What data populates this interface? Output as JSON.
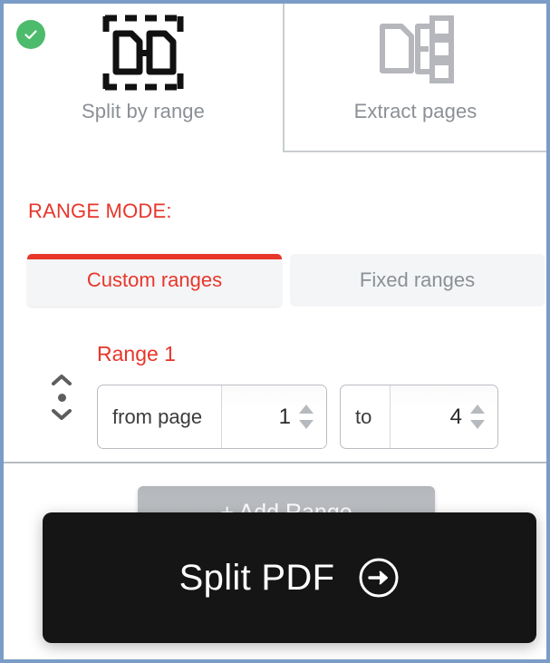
{
  "tabs": [
    {
      "id": "split-by-range",
      "label": "Split by range",
      "icon": "split-document-icon",
      "selected": true,
      "badge": "check-badge"
    },
    {
      "id": "extract-pages",
      "label": "Extract pages",
      "icon": "extract-pages-icon",
      "selected": false
    }
  ],
  "range_mode": {
    "heading": "RANGE MODE:",
    "options": [
      {
        "id": "custom-ranges",
        "label": "Custom ranges",
        "selected": true
      },
      {
        "id": "fixed-ranges",
        "label": "Fixed ranges",
        "selected": false
      }
    ]
  },
  "ranges": [
    {
      "title": "Range 1",
      "from": {
        "label": "from page",
        "value": "1"
      },
      "to": {
        "label": "to",
        "value": "4"
      }
    }
  ],
  "footer": {
    "add_range_label": "+ Add Range",
    "submit_label": "Split PDF",
    "submit_icon": "arrow-right-circle-icon"
  },
  "colors": {
    "accent_red": "#e8362b",
    "badge_green": "#4cbb6c",
    "submit_bg": "#151515",
    "muted_text": "#8b9096",
    "frame_border": "#7a9cc6"
  }
}
